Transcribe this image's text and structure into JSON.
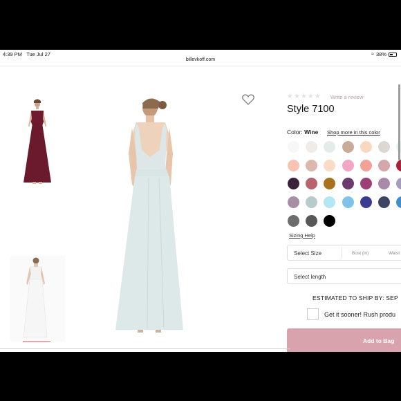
{
  "status": {
    "time": "4:39 PM",
    "date": "Tue Jul 27",
    "battery": "38%"
  },
  "browser": {
    "url": "billevkoff.com"
  },
  "product": {
    "review_link": "Write a review",
    "title": "Style 7100",
    "color_label": "Color:",
    "color_value": "Wine",
    "shop_more": "Shop more in this color",
    "sizing_help": "Sizing Help",
    "size_select": {
      "label": "Select Size",
      "col1": "Bust (in)",
      "col2": "Waist"
    },
    "length_select": {
      "label": "Select length"
    },
    "ship_text": "ESTIMATED TO SHIP BY: SEP",
    "rush_text": "Get it sooner! Rush produ",
    "add_to_bag": "Add to Bag"
  },
  "swatch_colors": [
    [
      "#f7f7f7",
      "#f0ebe4",
      "#e3ecea",
      "#c8ac9a",
      "#f8d9bf",
      "#ddd7d2",
      "#e6f3ef"
    ],
    [
      "#f8c4b2",
      "#dcb7ac",
      "#fadbc8",
      "#f3a6c4",
      "#f1a197",
      "#d6a7aa",
      "#a8223b"
    ],
    [
      "#3a2239",
      "#b9646c",
      "#a9731e",
      "#6b3b6d",
      "#9e3f78",
      "#aa8aa9",
      "#a49bbd"
    ],
    [
      "#a88ea5",
      "#b8cacb",
      "#b4e6f4",
      "#7fc3eb",
      "#3b3a93",
      "#3d4566",
      "#3e8ecd"
    ],
    [
      "#6d6d6d",
      "#585858",
      "#000000"
    ]
  ],
  "icons": {
    "heart": "heart-icon",
    "star": "star-icon",
    "wifi": "wifi-icon",
    "battery": "battery-icon"
  }
}
